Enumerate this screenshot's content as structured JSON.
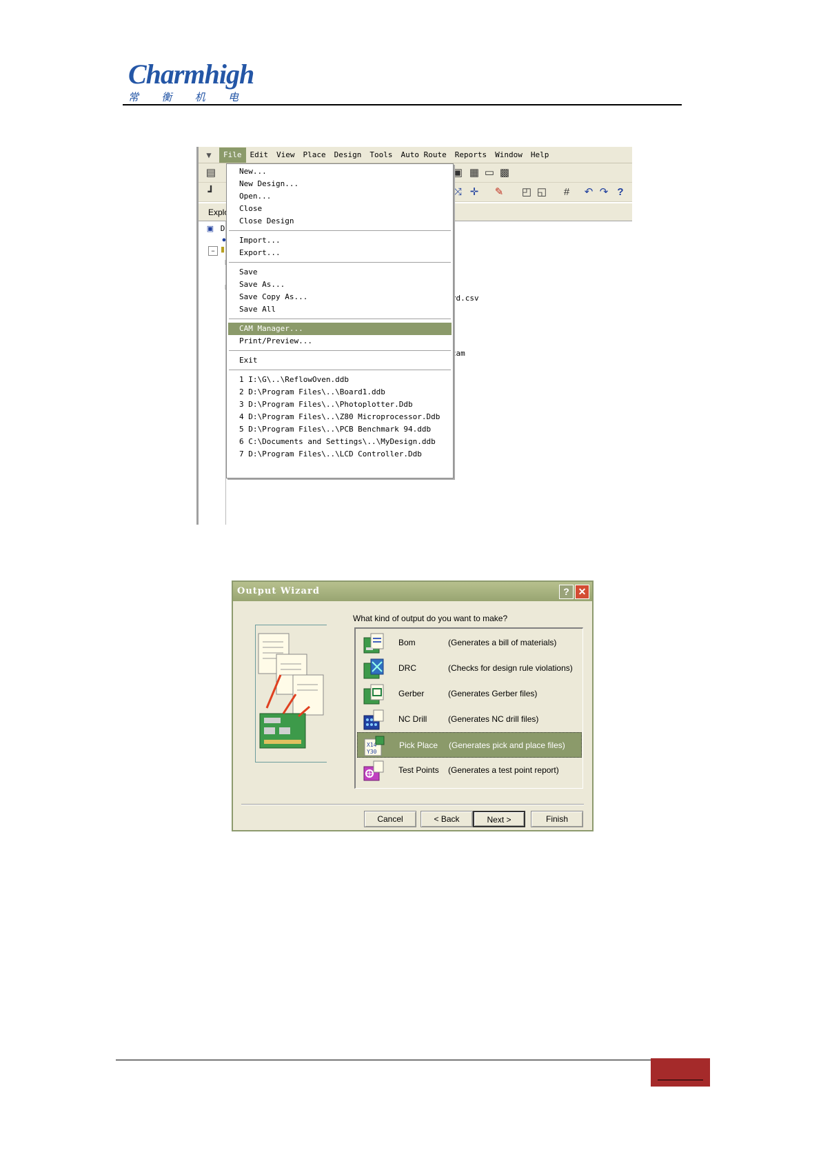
{
  "header": {
    "logo_text": "Charmhigh",
    "logo_cn": [
      "常",
      "衡",
      "机",
      "电"
    ]
  },
  "protel_screenshot": {
    "menubar": [
      "File",
      "Edit",
      "View",
      "Place",
      "Design",
      "Tools",
      "Auto Route",
      "Reports",
      "Window",
      "Help"
    ],
    "explorer_tab": "Explo",
    "tree_fragment": "D",
    "file_fragments": [
      "Board.csv",
      "rd.cam"
    ],
    "file_menu": {
      "groups": [
        [
          "New...",
          "New Design...",
          "Open...",
          "Close",
          "Close Design"
        ],
        [
          "Import...",
          "Export..."
        ],
        [
          "Save",
          "Save As...",
          "Save Copy As...",
          "Save All"
        ],
        [
          "CAM Manager...",
          "Print/Preview..."
        ],
        [
          "Exit"
        ],
        [
          "1 I:\\G\\..\\ReflowOven.ddb",
          "2 D:\\Program Files\\..\\Board1.ddb",
          "3 D:\\Program Files\\..\\Photoplotter.Ddb",
          "4 D:\\Program Files\\..\\Z80 Microprocessor.Ddb",
          "5 D:\\Program Files\\..\\PCB Benchmark 94.ddb",
          "6 C:\\Documents and Settings\\..\\MyDesign.ddb",
          "7 D:\\Program Files\\..\\LCD Controller.Ddb"
        ]
      ],
      "highlighted": "CAM Manager..."
    },
    "toolbar_icons": [
      "align-icon",
      "component-icon",
      "select-area-icon",
      "chip-icon",
      "layer-stack-icon",
      "ratsnest-icon",
      "route-icon",
      "move-icon",
      "pencil-icon",
      "library-icon",
      "library-browse-icon",
      "grid-icon",
      "undo-icon",
      "redo-icon",
      "help-icon"
    ]
  },
  "wizard": {
    "title": "Output Wizard",
    "question": "What kind of output do you want to make?",
    "options": [
      {
        "name": "Bom",
        "desc": "(Generates a bill of materials)",
        "icon": "bom-icon"
      },
      {
        "name": "DRC",
        "desc": "(Checks for design rule violations)",
        "icon": "drc-icon"
      },
      {
        "name": "Gerber",
        "desc": "(Generates Gerber files)",
        "icon": "gerber-icon"
      },
      {
        "name": "NC Drill",
        "desc": "(Generates NC drill files)",
        "icon": "nc-drill-icon"
      },
      {
        "name": "Pick Place",
        "desc": "(Generates pick and place files)",
        "icon": "pick-place-icon"
      },
      {
        "name": "Test Points",
        "desc": "(Generates a test point report)",
        "icon": "test-points-icon"
      }
    ],
    "selected": "Pick Place",
    "buttons": {
      "cancel": "Cancel",
      "back": "< Back",
      "next": "Next >",
      "finish": "Finish"
    },
    "help_glyph": "?",
    "close_glyph": "✕"
  },
  "colors": {
    "accent_olive": "#8b9a6a",
    "logo_blue": "#2456a6",
    "footer_red": "#a52a2a"
  }
}
